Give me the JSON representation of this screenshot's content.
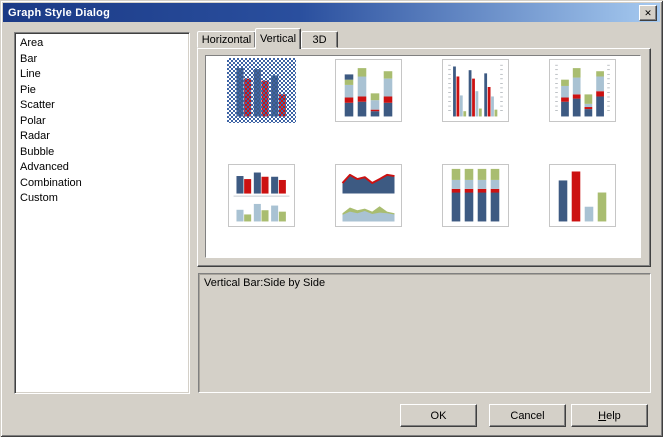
{
  "window": {
    "title": "Graph Style Dialog",
    "close_glyph": "✕"
  },
  "style_list": {
    "items": [
      "Area",
      "Bar",
      "Line",
      "Pie",
      "Scatter",
      "Polar",
      "Radar",
      "Bubble",
      "Advanced",
      "Combination",
      "Custom"
    ]
  },
  "tabs": {
    "items": [
      {
        "label": "Horizontal",
        "selected": false
      },
      {
        "label": "Vertical",
        "selected": true
      },
      {
        "label": "3D",
        "selected": false
      }
    ]
  },
  "preview": {
    "description": "Vertical Bar:Side by Side",
    "selected_thumbnail": "side-by-side"
  },
  "buttons": [
    {
      "label": "OK"
    },
    {
      "label": "Cancel"
    },
    {
      "label": "Help",
      "underline_first": true
    }
  ],
  "palette": {
    "navy": "#3d5a82",
    "red": "#cc1111",
    "ltblue": "#a9c2d3",
    "green": "#a9bd70",
    "selection_checker": "#3e64a5",
    "titlebar_left": "#1b3a86",
    "titlebar_right": "#a6caf0",
    "face": "#d4d0c8"
  },
  "thumbnails": [
    {
      "name": "side-by-side",
      "selected": true,
      "type": "grouped",
      "axes": false,
      "groups": [
        [
          [
            "navy",
            0.92
          ],
          [
            "red",
            0.72
          ]
        ],
        [
          [
            "navy",
            0.9
          ],
          [
            "red",
            0.68
          ]
        ],
        [
          [
            "navy",
            0.78
          ],
          [
            "red",
            0.42
          ]
        ]
      ]
    },
    {
      "name": "stacked",
      "selected": false,
      "type": "stacked",
      "axes": false,
      "bars": [
        [
          [
            "navy",
            0.26
          ],
          [
            "red",
            0.1
          ],
          [
            "ltblue",
            0.24
          ],
          [
            "green",
            0.1
          ],
          [
            "navy",
            0.1
          ]
        ],
        [
          [
            "navy",
            0.28
          ],
          [
            "red",
            0.1
          ],
          [
            "ltblue",
            0.38
          ],
          [
            "green",
            0.16
          ]
        ],
        [
          [
            "navy",
            0.1
          ],
          [
            "red",
            0.03
          ],
          [
            "ltblue",
            0.18
          ],
          [
            "green",
            0.13
          ]
        ],
        [
          [
            "navy",
            0.26
          ],
          [
            "red",
            0.12
          ],
          [
            "ltblue",
            0.34
          ],
          [
            "green",
            0.14
          ]
        ]
      ]
    },
    {
      "name": "side-by-side-axes",
      "selected": false,
      "type": "grouped",
      "axes": true,
      "groups": [
        [
          [
            "navy",
            0.95
          ],
          [
            "red",
            0.76
          ],
          [
            "ltblue",
            0.4
          ],
          [
            "green",
            0.1
          ]
        ],
        [
          [
            "navy",
            0.88
          ],
          [
            "red",
            0.72
          ],
          [
            "ltblue",
            0.48
          ],
          [
            "green",
            0.15
          ]
        ],
        [
          [
            "navy",
            0.82
          ],
          [
            "red",
            0.56
          ],
          [
            "ltblue",
            0.38
          ],
          [
            "green",
            0.13
          ]
        ]
      ]
    },
    {
      "name": "stacked-axes",
      "selected": false,
      "type": "stacked",
      "axes": true,
      "bars": [
        [
          [
            "navy",
            0.28
          ],
          [
            "red",
            0.08
          ],
          [
            "ltblue",
            0.22
          ],
          [
            "green",
            0.12
          ]
        ],
        [
          [
            "navy",
            0.34
          ],
          [
            "red",
            0.08
          ],
          [
            "ltblue",
            0.32
          ],
          [
            "green",
            0.18
          ]
        ],
        [
          [
            "navy",
            0.14
          ],
          [
            "red",
            0.04
          ],
          [
            "ltblue",
            0.06
          ],
          [
            "green",
            0.18
          ]
        ],
        [
          [
            "navy",
            0.38
          ],
          [
            "red",
            0.1
          ],
          [
            "ltblue",
            0.28
          ],
          [
            "green",
            0.1
          ]
        ]
      ]
    },
    {
      "name": "dual-panel-bars",
      "selected": false,
      "type": "panels-bars",
      "axes": false,
      "top": [
        [
          [
            "navy",
            0.75
          ],
          [
            "red",
            0.62
          ]
        ],
        [
          [
            "navy",
            0.9
          ],
          [
            "red",
            0.72
          ]
        ],
        [
          [
            "navy",
            0.72
          ],
          [
            "red",
            0.58
          ]
        ]
      ],
      "bottom": [
        [
          [
            "ltblue",
            0.5
          ],
          [
            "green",
            0.3
          ]
        ],
        [
          [
            "ltblue",
            0.75
          ],
          [
            "green",
            0.48
          ]
        ],
        [
          [
            "ltblue",
            0.68
          ],
          [
            "green",
            0.42
          ]
        ]
      ]
    },
    {
      "name": "dual-panel-areas",
      "selected": false,
      "type": "panels-areas",
      "axes": false,
      "top": {
        "fill": "navy",
        "stroke": "red",
        "values": [
          0.45,
          0.8,
          0.62,
          0.7,
          0.45,
          0.62,
          0.8,
          0.75
        ]
      },
      "bottom": [
        {
          "fill": "green",
          "values": [
            0.35,
            0.6,
            0.48,
            0.55,
            0.42,
            0.65,
            0.42,
            0.35
          ]
        },
        {
          "fill": "ltblue",
          "values": [
            0.28,
            0.42,
            0.35,
            0.45,
            0.32,
            0.38,
            0.35,
            0.3
          ]
        }
      ]
    },
    {
      "name": "stacked-100",
      "selected": false,
      "type": "stacked",
      "axes": false,
      "bars": [
        [
          [
            "navy",
            0.55
          ],
          [
            "red",
            0.07
          ],
          [
            "ltblue",
            0.17
          ],
          [
            "green",
            0.21
          ]
        ],
        [
          [
            "navy",
            0.55
          ],
          [
            "red",
            0.07
          ],
          [
            "ltblue",
            0.17
          ],
          [
            "green",
            0.21
          ]
        ],
        [
          [
            "navy",
            0.55
          ],
          [
            "red",
            0.07
          ],
          [
            "ltblue",
            0.17
          ],
          [
            "green",
            0.21
          ]
        ],
        [
          [
            "navy",
            0.55
          ],
          [
            "red",
            0.07
          ],
          [
            "ltblue",
            0.17
          ],
          [
            "green",
            0.21
          ]
        ]
      ]
    },
    {
      "name": "simple-bars",
      "selected": false,
      "type": "stacked",
      "axes": false,
      "bars": [
        [
          [
            "navy",
            0.78
          ]
        ],
        [
          [
            "red",
            0.95
          ]
        ],
        [
          [
            "ltblue",
            0.28
          ]
        ],
        [
          [
            "green",
            0.55
          ]
        ]
      ]
    }
  ],
  "layout_hints": {
    "thumb_columns": 4,
    "thumb_rows": 2
  }
}
